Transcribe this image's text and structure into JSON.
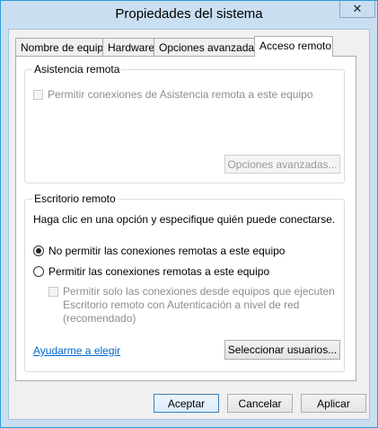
{
  "window": {
    "title": "Propiedades del sistema",
    "close_glyph": "✕"
  },
  "tabs": [
    {
      "label": "Nombre de equipo"
    },
    {
      "label": "Hardware"
    },
    {
      "label": "Opciones avanzadas"
    },
    {
      "label": "Acceso remoto",
      "active": true
    }
  ],
  "remote_assistance": {
    "legend": "Asistencia remota",
    "allow_label": "Permitir conexiones de Asistencia remota a este equipo",
    "allow_checked": false,
    "advanced_button": "Opciones avanzadas..."
  },
  "remote_desktop": {
    "legend": "Escritorio remoto",
    "instructions": "Haga clic en una opción y especifique quién puede conectarse.",
    "option_deny": "No permitir las conexiones remotas a este equipo",
    "option_allow": "Permitir las conexiones remotas a este equipo",
    "selected": "deny",
    "nla_line1": "Permitir solo las conexiones desde equipos que ejecuten",
    "nla_line2": "Escritorio remoto con Autenticación a nivel de red",
    "nla_line3": "(recomendado)",
    "help_link": "Ayudarme a elegir",
    "select_users_button": "Seleccionar usuarios..."
  },
  "footer": {
    "ok": "Aceptar",
    "cancel": "Cancelar",
    "apply": "Aplicar"
  }
}
